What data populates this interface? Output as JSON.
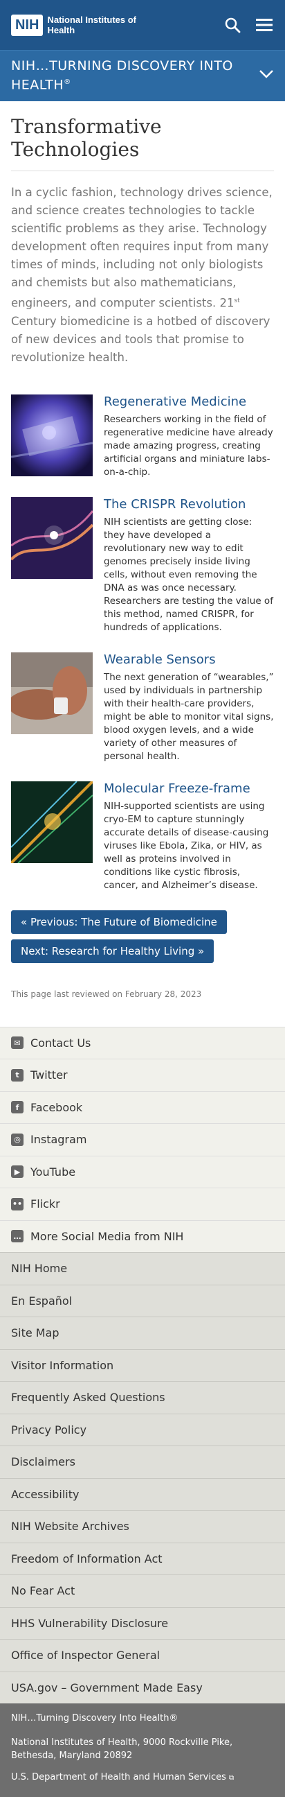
{
  "header": {
    "logo_abbrev": "NIH",
    "logo_text": "National Institutes of Health"
  },
  "section": {
    "title": "NIH…TURNING DISCOVERY INTO HEALTH",
    "title_mark": "®"
  },
  "main": {
    "title": "Transformative Technologies",
    "intro_part1": "In a cyclic fashion, technology drives science, and science creates technologies to tackle scientific problems as they arise.  Technology development often requires input from many times of minds, including not only biologists and chemists but also mathematicians, engineers, and computer scientists.  21",
    "intro_sup": "st",
    "intro_part2": " Century biomedicine is a hotbed of discovery of new devices and tools that promise to revolutionize health."
  },
  "features": [
    {
      "title": "Regenerative Medicine",
      "text": "Researchers working in the field of regenerative medicine have already made amazing progress, creating artificial organs and miniature labs-on-a-chip."
    },
    {
      "title": "The CRISPR Revolution",
      "text": "NIH scientists are getting close: they have developed a revolutionary new way to edit genomes precisely inside living cells, without even removing the DNA as was once necessary. Researchers are testing the value of this method, named CRISPR, for hundreds of applications."
    },
    {
      "title": "Wearable Sensors",
      "text": "The next generation of “wearables,” used by individuals in partnership with their health-care providers, might be able to monitor vital signs, blood oxygen levels, and a wide variety of other measures of personal health."
    },
    {
      "title": "Molecular Freeze-frame",
      "text": "NIH-supported scientists are using cryo-EM to capture stunningly accurate details of disease-causing viruses like Ebola, Zika, or HIV, as well as proteins involved in conditions like cystic fibrosis, cancer, and Alzheimer’s disease."
    }
  ],
  "nav": {
    "previous": "« Previous: The Future of Biomedicine",
    "next": "Next: Research for Healthy Living »"
  },
  "review": "This page last reviewed on February 28, 2023",
  "social": [
    {
      "label": "Contact Us",
      "icon": "mail-icon"
    },
    {
      "label": "Twitter",
      "icon": "twitter-icon"
    },
    {
      "label": "Facebook",
      "icon": "facebook-icon"
    },
    {
      "label": "Instagram",
      "icon": "instagram-icon"
    },
    {
      "label": "YouTube",
      "icon": "youtube-icon"
    },
    {
      "label": "Flickr",
      "icon": "flickr-icon"
    },
    {
      "label": "More Social Media from NIH",
      "icon": "chat-icon"
    }
  ],
  "links": [
    "NIH Home",
    "En Español",
    "Site Map",
    "Visitor Information",
    "Frequently Asked Questions",
    "Privacy Policy",
    "Disclaimers",
    "Accessibility",
    "NIH Website Archives",
    "Freedom of Information Act",
    "No Fear Act",
    "HHS Vulnerability Disclosure",
    "Office of Inspector General",
    "USA.gov – Government Made Easy"
  ],
  "footer": {
    "tagline": "NIH…Turning Discovery Into Health®",
    "address": "National Institutes of Health, 9000 Rockville Pike, Bethesda, Maryland 20892",
    "hhs": "U.S. Department of Health and Human Services"
  },
  "colors": {
    "header": "#20558a",
    "section_bar": "#2c6aa3",
    "accent": "#20558a"
  }
}
